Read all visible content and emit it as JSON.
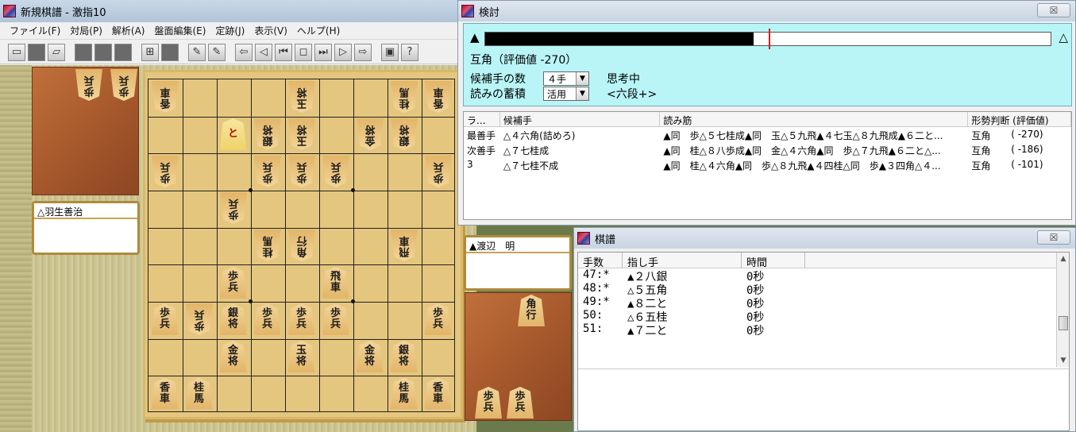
{
  "main_window": {
    "title": "新規棋譜 - 激指10",
    "menu": [
      "ファイル(F)",
      "対局(P)",
      "解析(A)",
      "盤面編集(E)",
      "定跡(J)",
      "表示(V)",
      "ヘルプ(H)"
    ]
  },
  "players": {
    "gote": "△羽生善治",
    "sente": "▲渡辺　明"
  },
  "board": {
    "pieces": [
      {
        "col": 0,
        "row": 0,
        "text": "香車",
        "gote": true
      },
      {
        "col": 4,
        "row": 0,
        "text": "玉将",
        "gote": true
      },
      {
        "col": 7,
        "row": 0,
        "text": "桂馬",
        "gote": true
      },
      {
        "col": 8,
        "row": 0,
        "text": "香車",
        "gote": true
      },
      {
        "col": 2,
        "row": 1,
        "text": "と",
        "gote": false,
        "red": true,
        "sel": true
      },
      {
        "col": 3,
        "row": 1,
        "text": "銀将",
        "gote": true
      },
      {
        "col": 4,
        "row": 1,
        "text": "玉将",
        "gote": true
      },
      {
        "col": 6,
        "row": 1,
        "text": "金将",
        "gote": true
      },
      {
        "col": 7,
        "row": 1,
        "text": "銀将",
        "gote": true
      },
      {
        "col": 0,
        "row": 2,
        "text": "歩兵",
        "gote": true
      },
      {
        "col": 3,
        "row": 2,
        "text": "歩兵",
        "gote": true
      },
      {
        "col": 4,
        "row": 2,
        "text": "歩兵",
        "gote": true
      },
      {
        "col": 5,
        "row": 2,
        "text": "歩兵",
        "gote": true
      },
      {
        "col": 8,
        "row": 2,
        "text": "歩兵",
        "gote": true
      },
      {
        "col": 2,
        "row": 3,
        "text": "歩兵",
        "gote": true
      },
      {
        "col": 3,
        "row": 4,
        "text": "桂馬",
        "gote": true
      },
      {
        "col": 4,
        "row": 4,
        "text": "角行",
        "gote": true
      },
      {
        "col": 7,
        "row": 4,
        "text": "飛車",
        "gote": true
      },
      {
        "col": 2,
        "row": 5,
        "text": "歩兵",
        "gote": false
      },
      {
        "col": 5,
        "row": 5,
        "text": "飛車",
        "gote": false
      },
      {
        "col": 0,
        "row": 6,
        "text": "歩兵",
        "gote": false
      },
      {
        "col": 1,
        "row": 6,
        "text": "歩兵",
        "gote": true
      },
      {
        "col": 2,
        "row": 6,
        "text": "銀将",
        "gote": false
      },
      {
        "col": 3,
        "row": 6,
        "text": "歩兵",
        "gote": false
      },
      {
        "col": 4,
        "row": 6,
        "text": "歩兵",
        "gote": false
      },
      {
        "col": 5,
        "row": 6,
        "text": "歩兵",
        "gote": false
      },
      {
        "col": 8,
        "row": 6,
        "text": "歩兵",
        "gote": false
      },
      {
        "col": 2,
        "row": 7,
        "text": "金将",
        "gote": false
      },
      {
        "col": 4,
        "row": 7,
        "text": "玉将",
        "gote": false
      },
      {
        "col": 6,
        "row": 7,
        "text": "金将",
        "gote": false
      },
      {
        "col": 7,
        "row": 7,
        "text": "銀将",
        "gote": false
      },
      {
        "col": 0,
        "row": 8,
        "text": "香車",
        "gote": false
      },
      {
        "col": 1,
        "row": 8,
        "text": "桂馬",
        "gote": false
      },
      {
        "col": 7,
        "row": 8,
        "text": "桂馬",
        "gote": false
      },
      {
        "col": 8,
        "row": 8,
        "text": "香車",
        "gote": false
      }
    ],
    "gote_hand": [
      "歩兵",
      "歩兵"
    ],
    "sente_hand_top": [
      "角行"
    ],
    "sente_hand_bottom": [
      "歩兵",
      "歩兵"
    ]
  },
  "analysis": {
    "title": "検討",
    "close": "☒",
    "eval_left": "▲",
    "eval_right": "△",
    "eval_fill_fraction": 0.475,
    "eval_marker_fraction": 0.502,
    "eval_text": "互角（評価値 -270）",
    "cand_label": "候補手の数",
    "cand_value": "４手",
    "accum_label": "読みの蓄積",
    "accum_value": "活用",
    "status": "思考中",
    "rank": "<六段+>",
    "columns": [
      "ラ...",
      "候補手",
      "読み筋",
      "形勢判断 (評価値)"
    ],
    "rows": [
      {
        "rank": "最善手",
        "move": "△４六角(詰めろ)",
        "line": "▲同　歩△５七桂成▲同　玉△５九飛▲４七玉△８九飛成▲６二と...",
        "judge": "互角",
        "value": "(  -270)"
      },
      {
        "rank": "次善手",
        "move": "△７七桂成",
        "line": "▲同　桂△８八歩成▲同　金△４六角▲同　歩△７九飛▲６二と△...",
        "judge": "互角",
        "value": "(  -186)"
      },
      {
        "rank": "3",
        "move": "△７七桂不成",
        "line": "▲同　桂△４六角▲同　歩△８九飛▲４四桂△同　歩▲３四角△４...",
        "judge": "互角",
        "value": "(  -101)"
      }
    ]
  },
  "kifu": {
    "title": "棋譜",
    "close": "☒",
    "columns": [
      "手数",
      "指し手",
      "時間"
    ],
    "rows": [
      {
        "num": "47:*",
        "move": "▲２八銀",
        "time": "0秒"
      },
      {
        "num": "48:*",
        "move": "△５五角",
        "time": "0秒"
      },
      {
        "num": "49:*",
        "move": "▲８二と",
        "time": "0秒"
      },
      {
        "num": "50:",
        "move": "△６五桂",
        "time": "0秒"
      },
      {
        "num": "51:",
        "move": "▲７二と",
        "time": "0秒"
      }
    ]
  }
}
